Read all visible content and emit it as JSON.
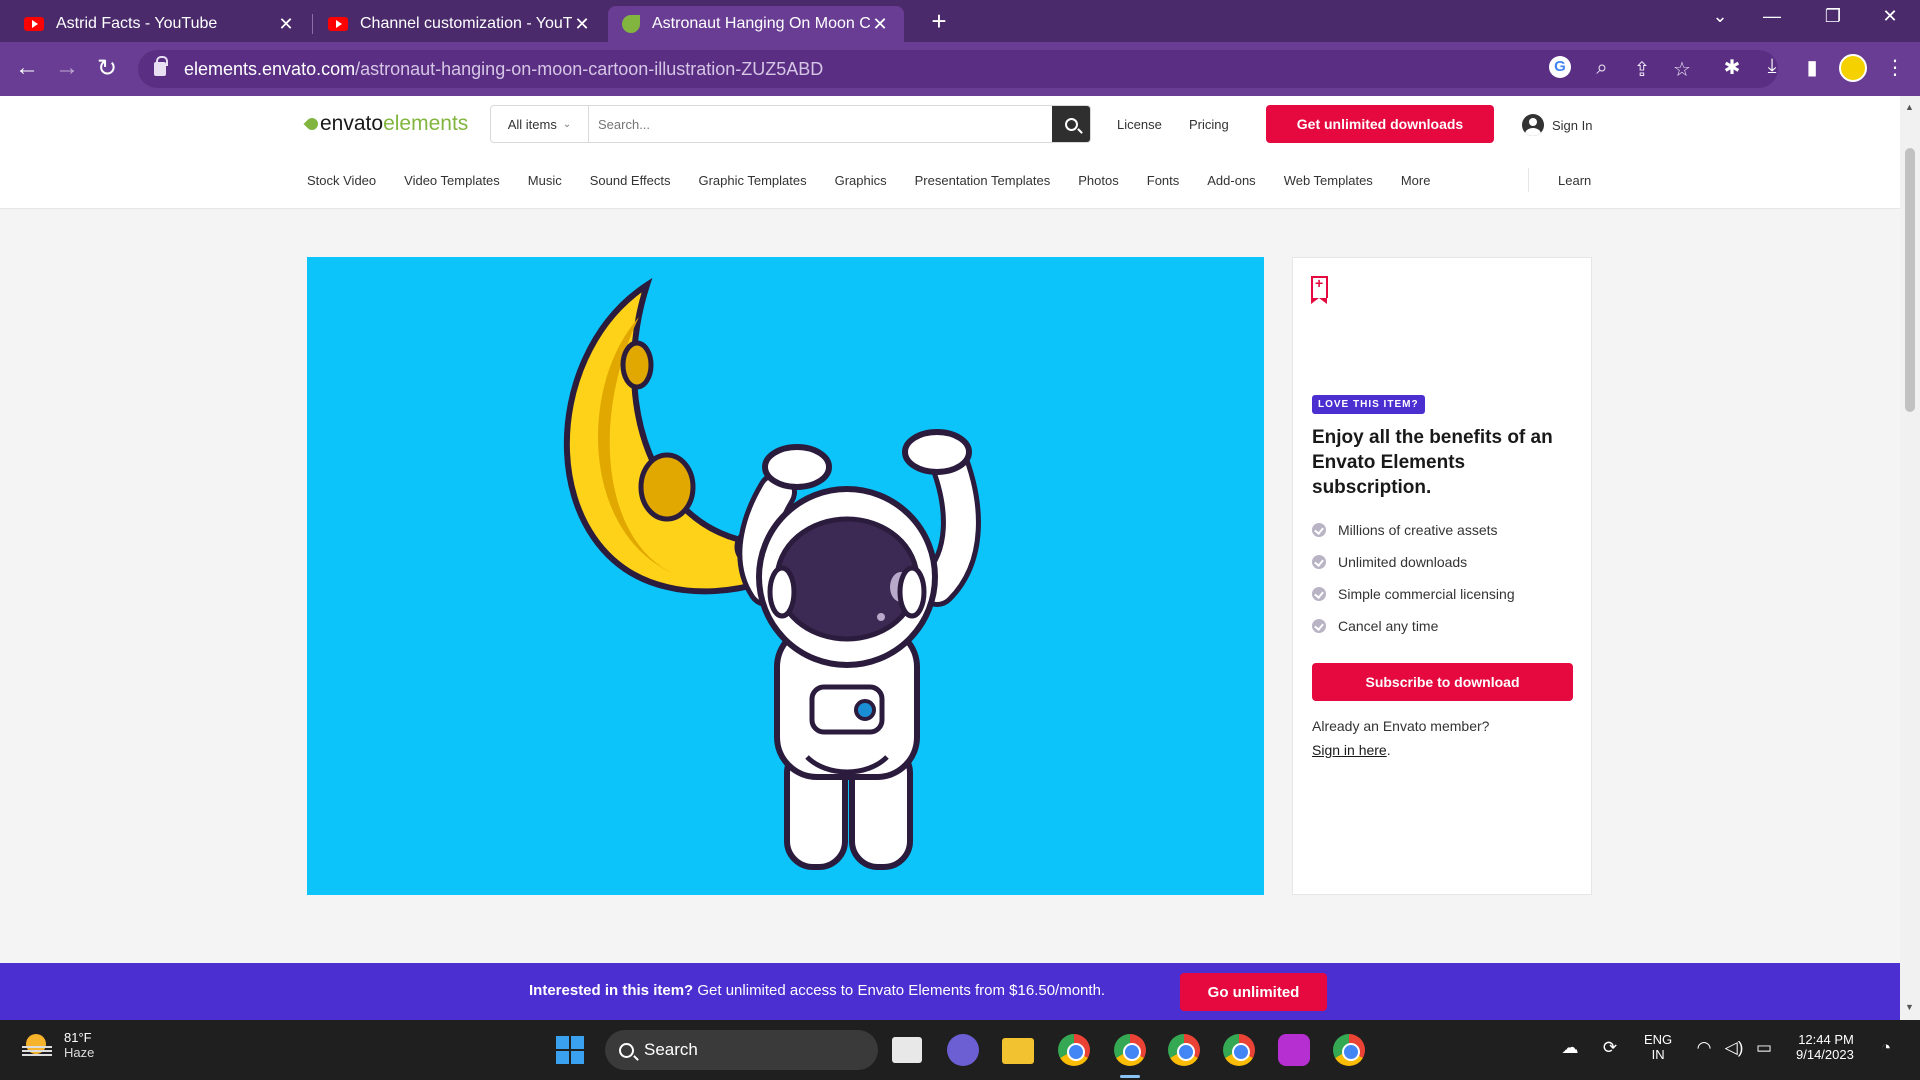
{
  "browser": {
    "tabs": [
      {
        "title": "Astrid Facts - YouTube",
        "active": false
      },
      {
        "title": "Channel customization - YouTube",
        "active": false
      },
      {
        "title": "Astronaut Hanging On Moon Cartoon Illustration",
        "active": true
      }
    ],
    "url_host": "elements.envato.com",
    "url_path": "/astronaut-hanging-on-moon-cartoon-illustration-ZUZ5ABD"
  },
  "header": {
    "logo_part1": "envato",
    "logo_part2": "elements",
    "search_category": "All items",
    "search_placeholder": "Search...",
    "license": "License",
    "pricing": "Pricing",
    "cta": "Get unlimited downloads",
    "signin": "Sign In"
  },
  "nav": {
    "items": [
      "Stock Video",
      "Video Templates",
      "Music",
      "Sound Effects",
      "Graphic Templates",
      "Graphics",
      "Presentation Templates",
      "Photos",
      "Fonts",
      "Add-ons",
      "Web Templates",
      "More"
    ],
    "learn": "Learn"
  },
  "sidebar": {
    "badge": "LOVE THIS ITEM?",
    "title": "Enjoy all the benefits of an Envato Elements subscription.",
    "benefits": [
      "Millions of creative assets",
      "Unlimited downloads",
      "Simple commercial licensing",
      "Cancel any time"
    ],
    "subscribe": "Subscribe to download",
    "member_question": "Already an Envato member?",
    "signin_link": "Sign in here",
    "signin_suffix": "."
  },
  "banner": {
    "bold": "Interested in this item?",
    "text": " Get unlimited access to Envato Elements from $16.50/month.",
    "button": "Go unlimited"
  },
  "taskbar": {
    "temp": "81°F",
    "condition": "Haze",
    "search": "Search",
    "lang1": "ENG",
    "lang2": "IN",
    "time": "12:44 PM",
    "date": "9/14/2023"
  },
  "colors": {
    "brand_red": "#e5093f",
    "brand_purple": "#4b2fd1",
    "preview_bg": "#0cc4f9"
  }
}
